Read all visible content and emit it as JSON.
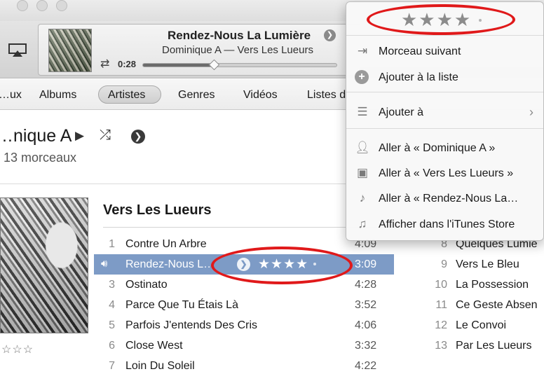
{
  "now_playing": {
    "title": "Rendez-Nous La Lumière",
    "subtitle": "Dominique A — Vers Les Lueurs",
    "elapsed": "0:28",
    "progress": 0.37
  },
  "nav": {
    "items": [
      "…ux",
      "Albums",
      "Artistes",
      "Genres",
      "Vidéos",
      "Listes d"
    ],
    "selected": "Artistes"
  },
  "artist": {
    "name": "…nique A",
    "track_count": "13 morceaux"
  },
  "album": {
    "name": "Vers Les Lueurs",
    "rating_stars": "☆☆☆",
    "tracks": [
      {
        "num": "1",
        "title": "Contre Un Arbre",
        "duration": "4:09"
      },
      {
        "num": "2",
        "title": "Rendez-Nous L…",
        "duration": "3:09",
        "rating": "★★★★"
      },
      {
        "num": "3",
        "title": "Ostinato",
        "duration": "4:28"
      },
      {
        "num": "4",
        "title": "Parce Que Tu Étais Là",
        "duration": "3:52"
      },
      {
        "num": "5",
        "title": "Parfois J'entends Des Cris",
        "duration": "4:06"
      },
      {
        "num": "6",
        "title": "Close West",
        "duration": "3:32"
      },
      {
        "num": "7",
        "title": "Loin Du Soleil",
        "duration": "4:22"
      }
    ],
    "tracks_right": [
      {
        "num": "8",
        "title": "Quelques Lumiè"
      },
      {
        "num": "9",
        "title": "Vers Le Bleu"
      },
      {
        "num": "10",
        "title": "La Possession"
      },
      {
        "num": "11",
        "title": "Ce Geste Absen"
      },
      {
        "num": "12",
        "title": "Le Convoi"
      },
      {
        "num": "13",
        "title": "Par Les Lueurs"
      }
    ]
  },
  "context_menu": {
    "rating_stars": "★★★★",
    "items": [
      {
        "label": "Morceau suivant",
        "icon": "next-track-icon"
      },
      {
        "label": "Ajouter à la liste",
        "icon": "add-circle-icon"
      },
      {
        "label": "Ajouter à",
        "icon": "add-to-playlist-icon",
        "submenu": true
      },
      {
        "label": "Aller à « Dominique A »",
        "icon": "artist-icon"
      },
      {
        "label": "Aller à « Vers Les Lueurs »",
        "icon": "album-icon"
      },
      {
        "label": "Aller à « Rendez-Nous La…",
        "icon": "song-icon"
      },
      {
        "label": "Afficher dans l'iTunes Store",
        "icon": "itunes-store-icon"
      }
    ]
  },
  "colors": {
    "selection": "#7d9bc6",
    "annotation": "#e0191a"
  }
}
